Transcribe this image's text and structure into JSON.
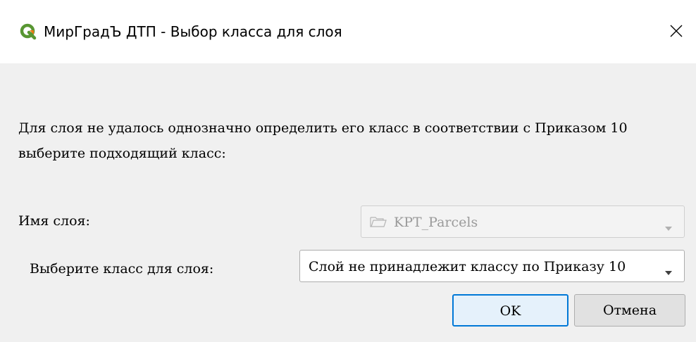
{
  "window": {
    "title": "МирГрадЪ ДТП - Выбор класса для слоя",
    "icon": "qgis-logo-icon",
    "close_icon": "close-icon"
  },
  "message": "Для слоя не удалось однозначно определить его класс в соответствии с Приказом 10 выберите подходящий класс:",
  "layer_field": {
    "label": "Имя слоя:",
    "value": "KPT_Parcels",
    "icon": "folder-icon",
    "enabled": false
  },
  "class_field": {
    "label": "Выберите класс для слоя:",
    "value": "Слой не принадлежит классу по Приказу 10"
  },
  "buttons": {
    "ok": "OK",
    "cancel": "Отмена"
  },
  "colors": {
    "accent": "#0078d7",
    "logo_green": "#589632",
    "logo_yellow": "#ee7913"
  }
}
